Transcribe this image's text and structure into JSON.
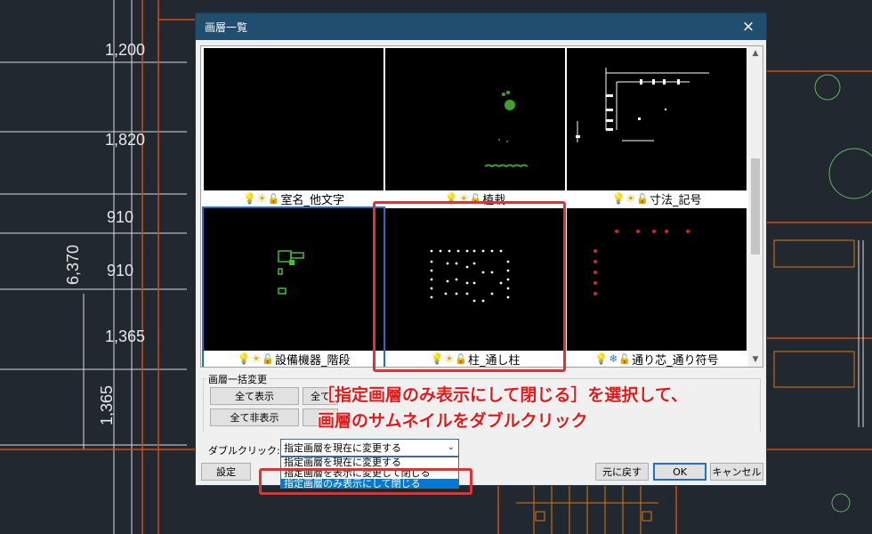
{
  "window": {
    "title": "画層一覧",
    "close_icon": "×"
  },
  "cad": {
    "dims": [
      "1,200",
      "1,820",
      "910",
      "910",
      "1,365"
    ],
    "dims_vertical": [
      "6,370",
      "1,365"
    ]
  },
  "layers": [
    {
      "name": "室名_他文字",
      "frozen": false
    },
    {
      "name": "植栽",
      "frozen": false
    },
    {
      "name": "寸法_記号",
      "frozen": false
    },
    {
      "name": "設備機器_階段",
      "frozen": false
    },
    {
      "name": "柱_通し柱",
      "frozen": false
    },
    {
      "name": "通り芯_通り符号",
      "frozen": true
    }
  ],
  "icons": {
    "bulb": "💡",
    "sun": "☀",
    "snow": "❄",
    "lock": "🔓"
  },
  "batch": {
    "label": "画層一括変更",
    "show_all": "全て表示",
    "hide_all": "全て非表示",
    "show_all2": "全て",
    "hide_all2": ""
  },
  "double_click": {
    "label": "ダブルクリック:",
    "selected": "指定画層を現在に変更する",
    "options": [
      "指定画層を現在に変更する",
      "指定画層を表示に変更して閉じる",
      "指定画層のみ表示にして閉じる"
    ]
  },
  "buttons": {
    "settings": "設定",
    "restore": "元に戻す",
    "ok": "OK",
    "cancel": "キャンセル"
  },
  "annotation": {
    "line1": "［指定画層のみ表示にして閉じる］を選択して、",
    "line2": "画層のサムネイルをダブルクリック"
  },
  "colors": {
    "accent": "#1f4e6e",
    "highlight": "#e53030",
    "cad_bg": "#212830",
    "cad_orange": "#e07a10"
  }
}
